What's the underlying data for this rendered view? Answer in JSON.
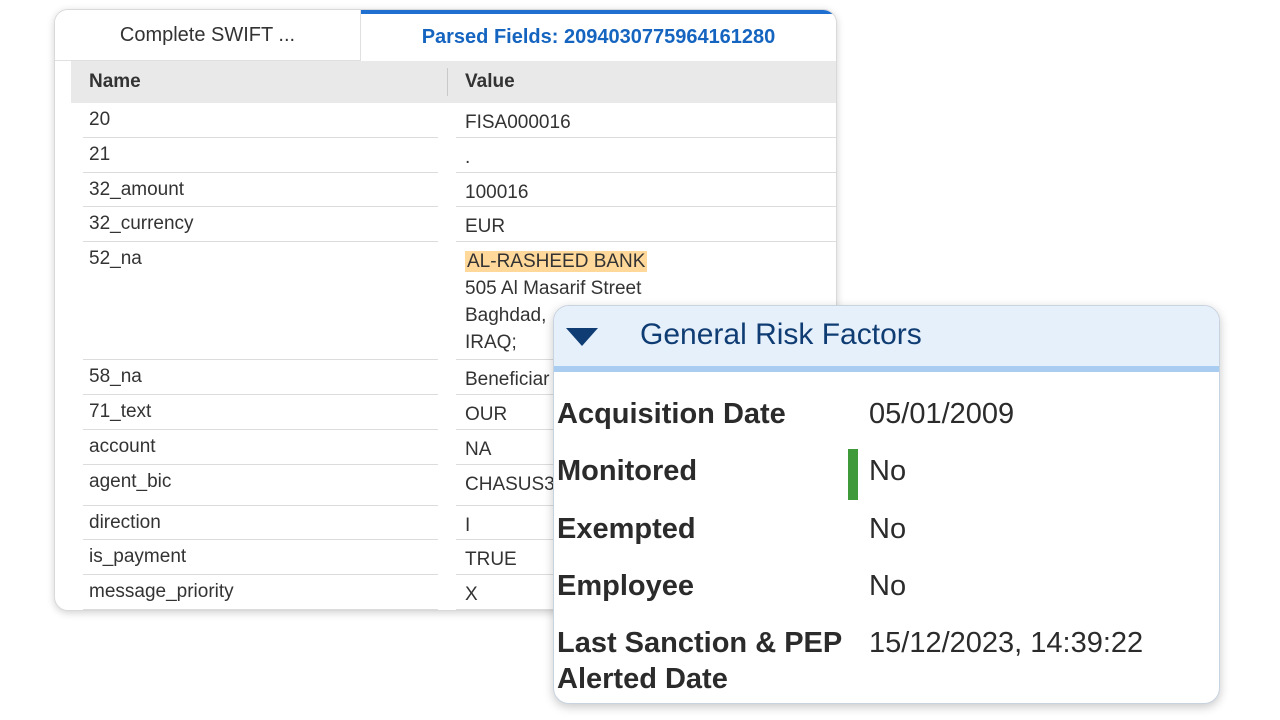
{
  "tabs": {
    "complete_swift": "Complete SWIFT ...",
    "parsed_fields": "Parsed Fields: 2094030775964161280"
  },
  "grid": {
    "col_name": "Name",
    "col_value": "Value",
    "rows": [
      {
        "name": "20",
        "value_lines": [
          "FISA000016"
        ]
      },
      {
        "name": "21",
        "value_lines": [
          "."
        ]
      },
      {
        "name": "32_amount",
        "value_lines": [
          "100016"
        ]
      },
      {
        "name": "32_currency",
        "value_lines": [
          "EUR"
        ]
      },
      {
        "name": "52_na",
        "value_lines": [
          "AL-RASHEED BANK",
          "505 Al Masarif Street",
          "Baghdad,",
          "IRAQ;"
        ]
      },
      {
        "name": "58_na",
        "value_lines": [
          "Beneficiar"
        ]
      },
      {
        "name": "71_text",
        "value_lines": [
          "OUR"
        ]
      },
      {
        "name": "account",
        "value_lines": [
          "NA"
        ]
      },
      {
        "name": "agent_bic",
        "value_lines": [
          "CHASUS3"
        ]
      },
      {
        "name": "direction",
        "value_lines": [
          "I"
        ]
      },
      {
        "name": "is_payment",
        "value_lines": [
          "TRUE"
        ]
      },
      {
        "name": "message_priority",
        "value_lines": [
          "X"
        ]
      }
    ]
  },
  "risk": {
    "title": "General Risk Factors",
    "chevron_icon": "chevron-down-icon",
    "rows": [
      {
        "label": "Acquisition Date",
        "value": "05/01/2009"
      },
      {
        "label": "Monitored",
        "value": "No"
      },
      {
        "label": "Exempted",
        "value": "No"
      },
      {
        "label": "Employee",
        "value": "No"
      },
      {
        "label": "Last Sanction & PEP Alerted Date",
        "value": "15/12/2023, 14:39:22"
      }
    ]
  },
  "colors": {
    "tab_active": "#1565c0",
    "highlight": "#ffd89a",
    "risk_header_bg": "#e6f0fb",
    "risk_title": "#0f3d73",
    "monitored_indicator": "#3f9a3a"
  }
}
